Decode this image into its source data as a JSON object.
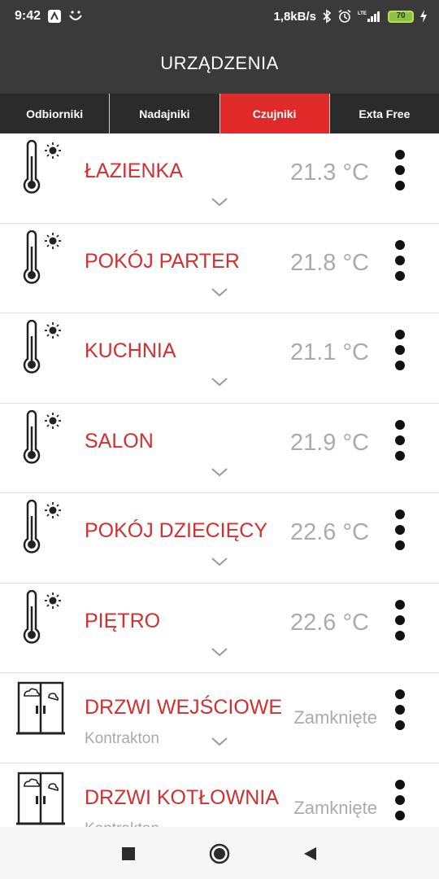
{
  "status_bar": {
    "time": "9:42",
    "speed": "1,8kB/s",
    "battery": "70",
    "network": "LTE",
    "icons": [
      "app-notification-icon",
      "face-icon",
      "bluetooth-icon",
      "alarm-icon",
      "signal-icon",
      "battery-icon",
      "charging-icon"
    ]
  },
  "app_bar": {
    "title": "URZĄDZENIA"
  },
  "tabs": [
    {
      "label": "Odbiorniki"
    },
    {
      "label": "Nadajniki"
    },
    {
      "label": "Czujniki",
      "active": true
    },
    {
      "label": "Exta Free"
    }
  ],
  "devices": [
    {
      "name": "ŁAZIENKA",
      "value": "21.3 °C",
      "icon": "thermometer-sun-icon"
    },
    {
      "name": "POKÓJ PARTER",
      "value": "21.8 °C",
      "icon": "thermometer-sun-icon"
    },
    {
      "name": "KUCHNIA",
      "value": "21.1 °C",
      "icon": "thermometer-sun-icon"
    },
    {
      "name": "SALON",
      "value": "21.9 °C",
      "icon": "thermometer-sun-icon"
    },
    {
      "name": "POKÓJ DZIECIĘCY",
      "value": "22.6 °C",
      "icon": "thermometer-sun-icon"
    },
    {
      "name": "PIĘTRO",
      "value": "22.6 °C",
      "icon": "thermometer-sun-icon"
    },
    {
      "name": "DRZWI WEJŚCIOWE",
      "subtitle": "Kontrakton",
      "value": "Zamknięte",
      "icon": "door-sensor-icon"
    },
    {
      "name": "DRZWI KOTŁOWNIA",
      "subtitle": "Kontrakton",
      "value": "Zamknięte",
      "icon": "door-sensor-icon"
    }
  ],
  "colors": {
    "accent": "#e02a2a",
    "device_name": "#d32f2f",
    "header": "#3a3a3a",
    "tabs_bg": "#2b2b2b"
  },
  "nav_bar": {
    "icons": [
      "recent-apps-icon",
      "home-icon",
      "back-icon"
    ]
  }
}
